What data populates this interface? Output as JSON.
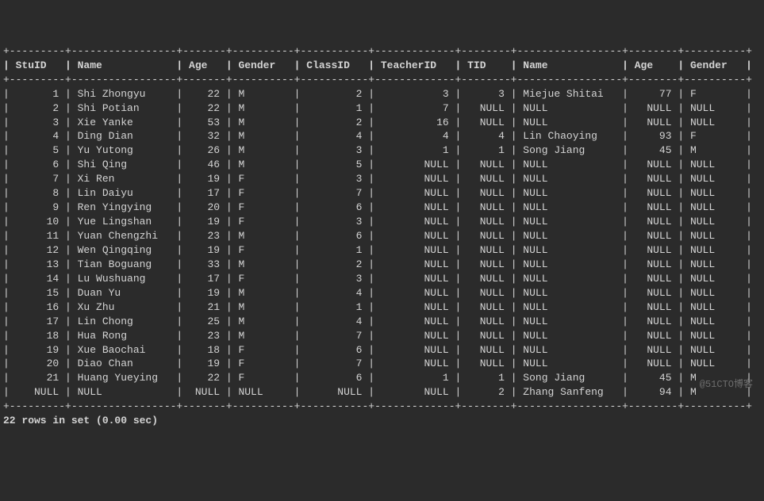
{
  "columns": [
    "StuID",
    "Name",
    "Age",
    "Gender",
    "ClassID",
    "TeacherID",
    "TID",
    "Name",
    "Age",
    "Gender"
  ],
  "aligns": [
    "r",
    "l",
    "r",
    "l",
    "r",
    "r",
    "r",
    "l",
    "r",
    "l"
  ],
  "widths": [
    7,
    15,
    5,
    8,
    9,
    11,
    6,
    15,
    6,
    8
  ],
  "rows": [
    [
      "1",
      "Shi Zhongyu",
      "22",
      "M",
      "2",
      "3",
      "3",
      "Miejue Shitai",
      "77",
      "F"
    ],
    [
      "2",
      "Shi Potian",
      "22",
      "M",
      "1",
      "7",
      "NULL",
      "NULL",
      "NULL",
      "NULL"
    ],
    [
      "3",
      "Xie Yanke",
      "53",
      "M",
      "2",
      "16",
      "NULL",
      "NULL",
      "NULL",
      "NULL"
    ],
    [
      "4",
      "Ding Dian",
      "32",
      "M",
      "4",
      "4",
      "4",
      "Lin Chaoying",
      "93",
      "F"
    ],
    [
      "5",
      "Yu Yutong",
      "26",
      "M",
      "3",
      "1",
      "1",
      "Song Jiang",
      "45",
      "M"
    ],
    [
      "6",
      "Shi Qing",
      "46",
      "M",
      "5",
      "NULL",
      "NULL",
      "NULL",
      "NULL",
      "NULL"
    ],
    [
      "7",
      "Xi Ren",
      "19",
      "F",
      "3",
      "NULL",
      "NULL",
      "NULL",
      "NULL",
      "NULL"
    ],
    [
      "8",
      "Lin Daiyu",
      "17",
      "F",
      "7",
      "NULL",
      "NULL",
      "NULL",
      "NULL",
      "NULL"
    ],
    [
      "9",
      "Ren Yingying",
      "20",
      "F",
      "6",
      "NULL",
      "NULL",
      "NULL",
      "NULL",
      "NULL"
    ],
    [
      "10",
      "Yue Lingshan",
      "19",
      "F",
      "3",
      "NULL",
      "NULL",
      "NULL",
      "NULL",
      "NULL"
    ],
    [
      "11",
      "Yuan Chengzhi",
      "23",
      "M",
      "6",
      "NULL",
      "NULL",
      "NULL",
      "NULL",
      "NULL"
    ],
    [
      "12",
      "Wen Qingqing",
      "19",
      "F",
      "1",
      "NULL",
      "NULL",
      "NULL",
      "NULL",
      "NULL"
    ],
    [
      "13",
      "Tian Boguang",
      "33",
      "M",
      "2",
      "NULL",
      "NULL",
      "NULL",
      "NULL",
      "NULL"
    ],
    [
      "14",
      "Lu Wushuang",
      "17",
      "F",
      "3",
      "NULL",
      "NULL",
      "NULL",
      "NULL",
      "NULL"
    ],
    [
      "15",
      "Duan Yu",
      "19",
      "M",
      "4",
      "NULL",
      "NULL",
      "NULL",
      "NULL",
      "NULL"
    ],
    [
      "16",
      "Xu Zhu",
      "21",
      "M",
      "1",
      "NULL",
      "NULL",
      "NULL",
      "NULL",
      "NULL"
    ],
    [
      "17",
      "Lin Chong",
      "25",
      "M",
      "4",
      "NULL",
      "NULL",
      "NULL",
      "NULL",
      "NULL"
    ],
    [
      "18",
      "Hua Rong",
      "23",
      "M",
      "7",
      "NULL",
      "NULL",
      "NULL",
      "NULL",
      "NULL"
    ],
    [
      "19",
      "Xue Baochai",
      "18",
      "F",
      "6",
      "NULL",
      "NULL",
      "NULL",
      "NULL",
      "NULL"
    ],
    [
      "20",
      "Diao Chan",
      "19",
      "F",
      "7",
      "NULL",
      "NULL",
      "NULL",
      "NULL",
      "NULL"
    ],
    [
      "21",
      "Huang Yueying",
      "22",
      "F",
      "6",
      "1",
      "1",
      "Song Jiang",
      "45",
      "M"
    ],
    [
      "NULL",
      "NULL",
      "NULL",
      "NULL",
      "NULL",
      "NULL",
      "2",
      "Zhang Sanfeng",
      "94",
      "M"
    ]
  ],
  "footer": "22 rows in set (0.00 sec)",
  "watermark": "@51CTO博客"
}
